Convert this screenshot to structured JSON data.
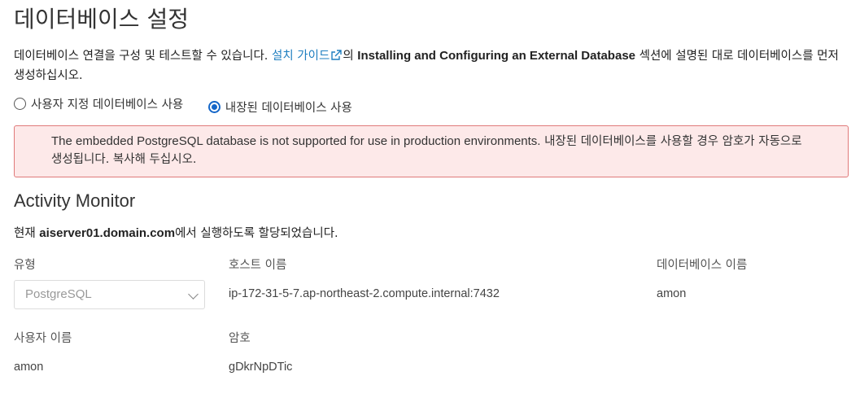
{
  "page_title": "데이터베이스 설정",
  "intro": {
    "text_before": "데이터베이스 연결을 구성 및 테스트할 수 있습니다. ",
    "link_label": "설치 가이드",
    "text_mid": "의 ",
    "bold_text": "Installing and Configuring an External Database",
    "text_after": " 섹션에 설명된 대로 데이터베이스를 먼저 생성하십시오."
  },
  "radios": [
    {
      "label": "사용자 지정 데이터베이스 사용",
      "checked": false
    },
    {
      "label": "내장된 데이터베이스 사용",
      "checked": true
    }
  ],
  "alert": {
    "text_en": "The embedded PostgreSQL database is not supported for use in production environments.",
    "text_ko": " 내장된 데이터베이스를 사용할 경우 암호가 자동으로 생성됩니다. 복사해 두십시오."
  },
  "section_title": "Activity Monitor",
  "assigned": {
    "prefix": "현재 ",
    "host": "aiserver01.domain.com",
    "suffix": "에서 실행하도록 할당되었습니다."
  },
  "fields": {
    "type_label": "유형",
    "type_value": "PostgreSQL",
    "host_label": "호스트 이름",
    "host_value": "ip-172-31-5-7.ap-northeast-2.compute.internal:7432",
    "db_label": "데이터베이스 이름",
    "db_value": "amon",
    "user_label": "사용자 이름",
    "user_value": "amon",
    "password_label": "암호",
    "password_value": "gDkrNpDTic"
  },
  "colors": {
    "link": "#1f7fc0",
    "alert_bg": "#fde9e9",
    "alert_border": "#e07a7a",
    "radio_accent": "#1466c8"
  }
}
